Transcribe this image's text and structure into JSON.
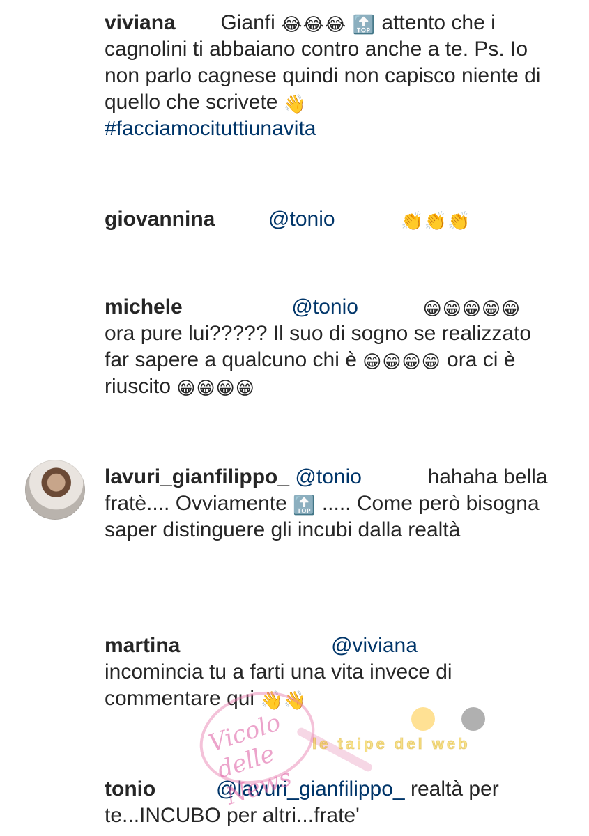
{
  "comments": [
    {
      "user": "viviana",
      "parts": [
        "Gianfi",
        "😂😂😂",
        "🔝",
        "attento che i cagnolini ti abbaiano contro anche a te. Ps. Io non parlo cagnese quindi non capisco niente di quello che scrivete",
        "👋",
        "#facciamocituttiunavita"
      ]
    },
    {
      "user": "giovannina",
      "parts": [
        "@tonio",
        "👏👏👏"
      ]
    },
    {
      "user": "michele",
      "parts": [
        "@tonio",
        "😁😁😁😁😁",
        "ora pure lui????? Il suo di sogno se realizzato far sapere a qualcuno chi è",
        "😁😁😁😁",
        "ora ci è riuscito",
        "😁😁😁😁"
      ]
    },
    {
      "user": "lavuri_gianfilippo_",
      "parts": [
        "@tonio",
        "hahaha bella fratè.... Ovviamente",
        "🔝",
        "..... Come però bisogna saper distinguere gli incubi dalla realtà"
      ]
    },
    {
      "user": "martina",
      "parts": [
        "@viviana",
        "incomincia tu a farti una vita invece di commentare qui",
        "👋👋"
      ]
    },
    {
      "user": "tonio",
      "parts": [
        "@lavuri_gianfilippo_",
        "realtà per te...INCUBO per altri...frate'"
      ]
    }
  ],
  "avatar_icon": "user-avatar-photo",
  "watermark": {
    "logo_text": "Vicolo delle News",
    "banner_text": "le taipe del web"
  },
  "colors": {
    "text": "#262626",
    "mention": "#003569",
    "background": "#ffffff"
  }
}
